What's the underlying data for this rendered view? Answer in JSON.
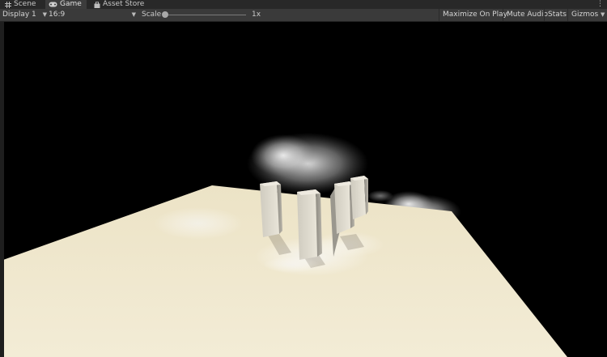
{
  "tabs": [
    {
      "label": "Scene",
      "icon": "grid-icon",
      "active": false
    },
    {
      "label": "Game",
      "icon": "gamepad-icon",
      "active": true
    },
    {
      "label": "Asset Store",
      "icon": "shopping-bag-icon",
      "active": false
    }
  ],
  "toolbar": {
    "display": "Display 1",
    "aspect": "16:9",
    "scale_label": "Scale",
    "scale_value": "1x",
    "scale_fraction": 0.0,
    "maximize_label": "Maximize On Play",
    "mute_label": "Mute Audio",
    "stats_label": "Stats",
    "gizmos_label": "Gizmos"
  },
  "colors": {
    "ground": "#efe7cf",
    "sky": "#000000",
    "pillar": "#d6d1c2"
  }
}
